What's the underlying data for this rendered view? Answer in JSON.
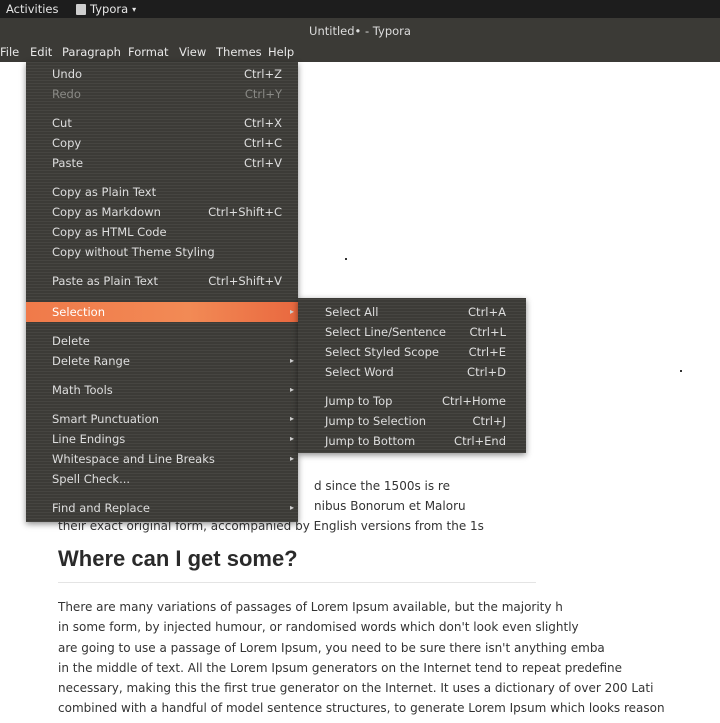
{
  "topbar": {
    "activities": "Activities",
    "app_name": "Typora",
    "app_caret": "▾"
  },
  "window": {
    "title": "Untitled• - Typora"
  },
  "menubar": [
    "File",
    "Edit",
    "Paragraph",
    "Format",
    "View",
    "Themes",
    "Help"
  ],
  "edit_menu": {
    "undo": {
      "label": "Undo",
      "shortcut": "Ctrl+Z"
    },
    "redo": {
      "label": "Redo",
      "shortcut": "Ctrl+Y"
    },
    "cut": {
      "label": "Cut",
      "shortcut": "Ctrl+X"
    },
    "copy": {
      "label": "Copy",
      "shortcut": "Ctrl+C"
    },
    "paste": {
      "label": "Paste",
      "shortcut": "Ctrl+V"
    },
    "copy_plain": {
      "label": "Copy as Plain Text"
    },
    "copy_markdown": {
      "label": "Copy as Markdown",
      "shortcut": "Ctrl+Shift+C"
    },
    "copy_html": {
      "label": "Copy as HTML Code"
    },
    "copy_no_theme": {
      "label": "Copy without Theme Styling"
    },
    "paste_plain": {
      "label": "Paste as Plain Text",
      "shortcut": "Ctrl+Shift+V"
    },
    "selection": {
      "label": "Selection"
    },
    "delete": {
      "label": "Delete"
    },
    "delete_range": {
      "label": "Delete Range"
    },
    "math_tools": {
      "label": "Math Tools"
    },
    "smart_punctuation": {
      "label": "Smart Punctuation"
    },
    "line_endings": {
      "label": "Line Endings"
    },
    "whitespace": {
      "label": "Whitespace and Line Breaks"
    },
    "spell_check": {
      "label": "Spell Check..."
    },
    "find_replace": {
      "label": "Find and Replace"
    }
  },
  "selection_menu": {
    "select_all": {
      "label": "Select All",
      "shortcut": "Ctrl+A"
    },
    "select_line": {
      "label": "Select Line/Sentence",
      "shortcut": "Ctrl+L"
    },
    "select_scope": {
      "label": "Select Styled Scope",
      "shortcut": "Ctrl+E"
    },
    "select_word": {
      "label": "Select Word",
      "shortcut": "Ctrl+D"
    },
    "jump_top": {
      "label": "Jump to Top",
      "shortcut": "Ctrl+Home"
    },
    "jump_selection": {
      "label": "Jump to Selection",
      "shortcut": "Ctrl+J"
    },
    "jump_bottom": {
      "label": "Jump to Bottom",
      "shortcut": "Ctrl+End"
    }
  },
  "document": {
    "p1_line1": "d since the 1500s is re",
    "p1_line2": "nibus Bonorum et Maloru",
    "p1_line3": "their exact original form, accompanied by English versions from the 1s",
    "heading": "Where can I get some?",
    "p2_lines": [
      "There are many variations of passages of Lorem Ipsum available, but  the majority h",
      "in some form, by injected humour,  or randomised words which don't look even slightly",
      "are going to use a passage of Lorem Ipsum, you need to be sure there  isn't anything emba",
      "in the middle of text. All the Lorem  Ipsum generators on the Internet tend to repeat predefine",
      "necessary, making this the first true generator on the Internet. It uses a dictionary of over 200 Lati",
      "combined with a handful of model  sentence structures, to generate Lorem Ipsum which looks reason"
    ]
  }
}
